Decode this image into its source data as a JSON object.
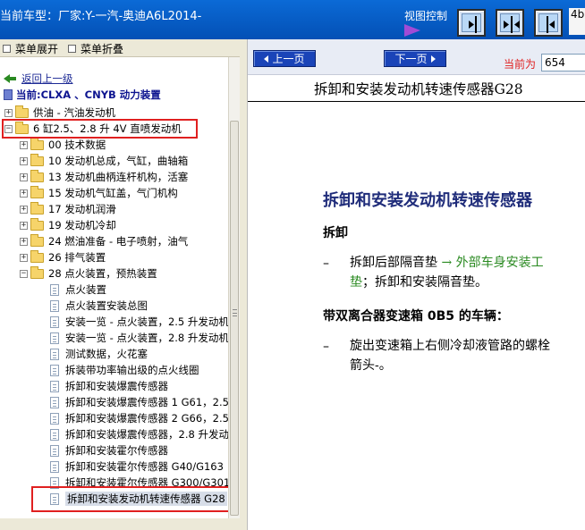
{
  "header": {
    "vehicle": "当前车型：厂家:Y-一汽-奥迪A6L2014-",
    "view_control": "视图控制",
    "right_edge": "4b"
  },
  "left_toolbar": {
    "expand": "菜单展开",
    "collapse": "菜单折叠"
  },
  "tree": {
    "back": "返回上一级",
    "current": "当前:CLXA 、CNYB 动力装置",
    "items": [
      {
        "label": "供油 - 汽油发动机",
        "type": "folder",
        "sign": "+"
      },
      {
        "label": "6 缸2.5、2.8 升 4V 直喷发动机",
        "type": "folder",
        "sign": "−"
      },
      {
        "label": "00 技术数据",
        "type": "folder",
        "sign": "+"
      },
      {
        "label": "10 发动机总成，气缸，曲轴箱",
        "type": "folder",
        "sign": "+"
      },
      {
        "label": "13 发动机曲柄连杆机构，活塞",
        "type": "folder",
        "sign": "+"
      },
      {
        "label": "15 发动机气缸盖，气门机构",
        "type": "folder",
        "sign": "+"
      },
      {
        "label": "17 发动机润滑",
        "type": "folder",
        "sign": "+"
      },
      {
        "label": "19 发动机冷却",
        "type": "folder",
        "sign": "+"
      },
      {
        "label": "24 燃油准备 - 电子喷射，油气",
        "type": "folder",
        "sign": "+"
      },
      {
        "label": "26 排气装置",
        "type": "folder",
        "sign": "+"
      },
      {
        "label": "28 点火装置，预热装置",
        "type": "folder",
        "sign": "−"
      },
      {
        "label": "点火装置",
        "type": "doc"
      },
      {
        "label": "点火装置安装总图",
        "type": "doc"
      },
      {
        "label": "安装一览 - 点火装置，2.5 升发动机",
        "type": "doc"
      },
      {
        "label": "安装一览 - 点火装置，2.8 升发动机",
        "type": "doc"
      },
      {
        "label": "测试数据，火花塞",
        "type": "doc"
      },
      {
        "label": "拆装带功率输出级的点火线圈",
        "type": "doc"
      },
      {
        "label": "拆卸和安装爆震传感器",
        "type": "doc"
      },
      {
        "label": "拆卸和安装爆震传感器 1 G61，2.5",
        "type": "doc"
      },
      {
        "label": "拆卸和安装爆震传感器 2 G66，2.5",
        "type": "doc"
      },
      {
        "label": "拆卸和安装爆震传感器，2.8 升发动机",
        "type": "doc"
      },
      {
        "label": "拆卸和安装霍尔传感器",
        "type": "doc"
      },
      {
        "label": "拆卸和安装霍尔传感器 G40/G163",
        "type": "doc"
      },
      {
        "label": "拆卸和安装霍尔传感器 G300/G301",
        "type": "doc"
      },
      {
        "label": "拆卸和安装发动机转速传感器 G28",
        "type": "doc"
      }
    ]
  },
  "nav": {
    "prev": "上一页",
    "next": "下一页",
    "current_label": "当前为",
    "page_value": "654"
  },
  "content": {
    "header": "拆卸和安装发动机转速传感器G28",
    "title": "拆卸和安装发动机转速传感器",
    "section1": "拆卸",
    "dash": "–",
    "step1_line1_pre": "拆卸后部隔音垫 ",
    "step1_line1_link": "→ 外部车身安装工",
    "step1_line2_link": "垫",
    "step1_line2_rest": "；拆卸和安装隔音垫。",
    "section2": "带双离合器变速箱 0B5 的车辆：",
    "step2_line1": "旋出变速箱上右侧冷却液管路的螺栓",
    "step2_line2": "箭头-。"
  }
}
